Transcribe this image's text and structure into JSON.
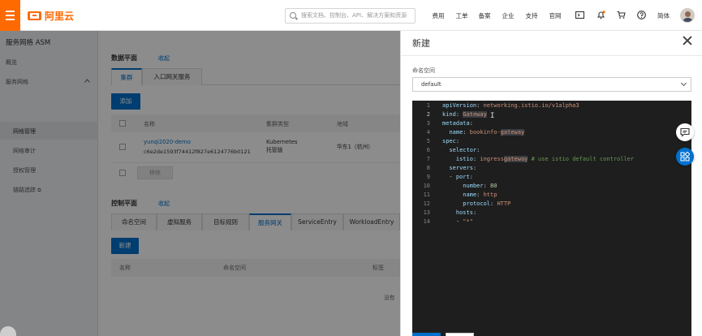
{
  "topbar": {
    "logo_text": "阿里云",
    "search_placeholder": "搜索文档、控制台、API、解决方案和资源",
    "nav": [
      "费用",
      "工单",
      "备案",
      "企业",
      "支持",
      "官网"
    ],
    "lang": "简体",
    "icons": [
      "menu-icon",
      "terminal-icon",
      "bell-icon",
      "cart-icon",
      "help-icon"
    ]
  },
  "sidebar": {
    "title": "服务网格 ASM",
    "items": [
      {
        "label": "概览"
      },
      {
        "label": "服务网格"
      },
      {
        "label": "网格管理"
      },
      {
        "label": "网格审计"
      },
      {
        "label": "授权管理"
      },
      {
        "label": "链路追踪"
      }
    ]
  },
  "main": {
    "data_plane": {
      "title": "数据平面",
      "collapse": "收起",
      "tabs": [
        "集群",
        "入口网关服务"
      ],
      "add_button": "添加",
      "columns": [
        "名称",
        "集群类型",
        "地域"
      ],
      "rows": [
        {
          "name": "yunqi2020-demo",
          "id": "c6e2de1593f74412f827e6124776b0121",
          "type": "Kubernetes 托管版",
          "region": "华东1（杭州）"
        }
      ],
      "remove_button": "移除"
    },
    "control_plane": {
      "title": "控制平面",
      "collapse": "收起",
      "tabs": [
        "命名空间",
        "虚拟服务",
        "目标规则",
        "服务网关",
        "ServiceEntry",
        "WorkloadEntry"
      ],
      "new_button": "新建",
      "columns": [
        "名称",
        "命名空间",
        "标签"
      ],
      "empty_text": "没有"
    }
  },
  "drawer": {
    "title": "新建",
    "namespace_label": "命名空间",
    "namespace_value": "default",
    "code_lines": [
      "apiVersion: networking.istio.io/v1alpha3",
      "kind: Gateway",
      "metadata:",
      "  name: bookinfo-gateway",
      "spec:",
      "  selector:",
      "    istio: ingressgateway # use istio default controller",
      "  servers:",
      "  - port:",
      "      number: 80",
      "      name: http",
      "      protocol: HTTP",
      "    hosts:",
      "    - \"*\""
    ],
    "line_numbers": [
      "1",
      "2",
      "3",
      "4",
      "5",
      "6",
      "7",
      "8",
      "9",
      "10",
      "11",
      "12",
      "13",
      "14"
    ]
  },
  "colors": {
    "brand": "#ff6a00",
    "primary": "#0070cc",
    "editor_bg": "#1e1e1e"
  }
}
